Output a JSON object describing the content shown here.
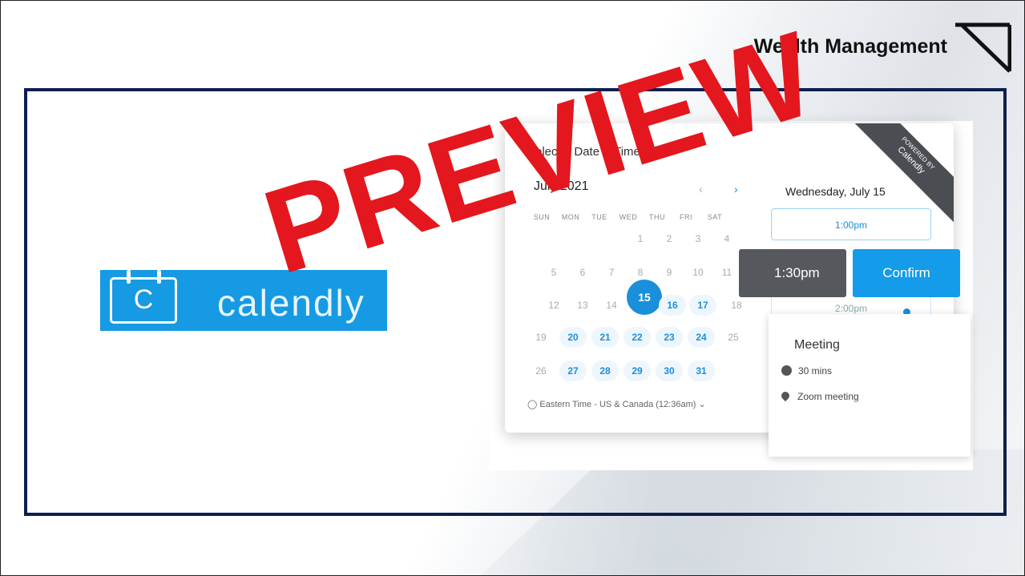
{
  "header": {
    "brand_text": "Wealth Management",
    "logo_icon": "triangle-logo-icon"
  },
  "calendly_logo": {
    "wordmark": "calendly",
    "icon_letter": "C",
    "color": "#169ae3"
  },
  "booking": {
    "title": "Select a Date & Time",
    "ribbon_top": "POWERED BY",
    "ribbon_brand": "Calendly",
    "month": "July 2021",
    "prev_icon": "‹",
    "next_icon": "›",
    "day_names": [
      "SUN",
      "MON",
      "TUE",
      "WED",
      "THU",
      "FRI",
      "SAT"
    ],
    "week1": [
      "",
      "",
      "",
      "1",
      "2",
      "3",
      "4"
    ],
    "week2": [
      "5",
      "6",
      "7",
      "8",
      "9",
      "10",
      "11"
    ],
    "week3": [
      "12",
      "13",
      "14",
      "15",
      "16",
      "17",
      "18"
    ],
    "week4": [
      "19",
      "20",
      "21",
      "22",
      "23",
      "24",
      "25"
    ],
    "week5": [
      "26",
      "27",
      "28",
      "29",
      "30",
      "31",
      ""
    ],
    "selected_day": "15",
    "timezone": "Eastern Time - US & Canada (12:36am) ⌄",
    "selected_date_header": "Wednesday, July 15",
    "slot_1": "1:00pm",
    "slot_selected": "1:30pm",
    "confirm": "Confirm",
    "slot_3": "2:00pm"
  },
  "meeting": {
    "title": "Meeting",
    "duration": "30 mins",
    "location": "Zoom meeting"
  },
  "watermark": "PREVIEW"
}
